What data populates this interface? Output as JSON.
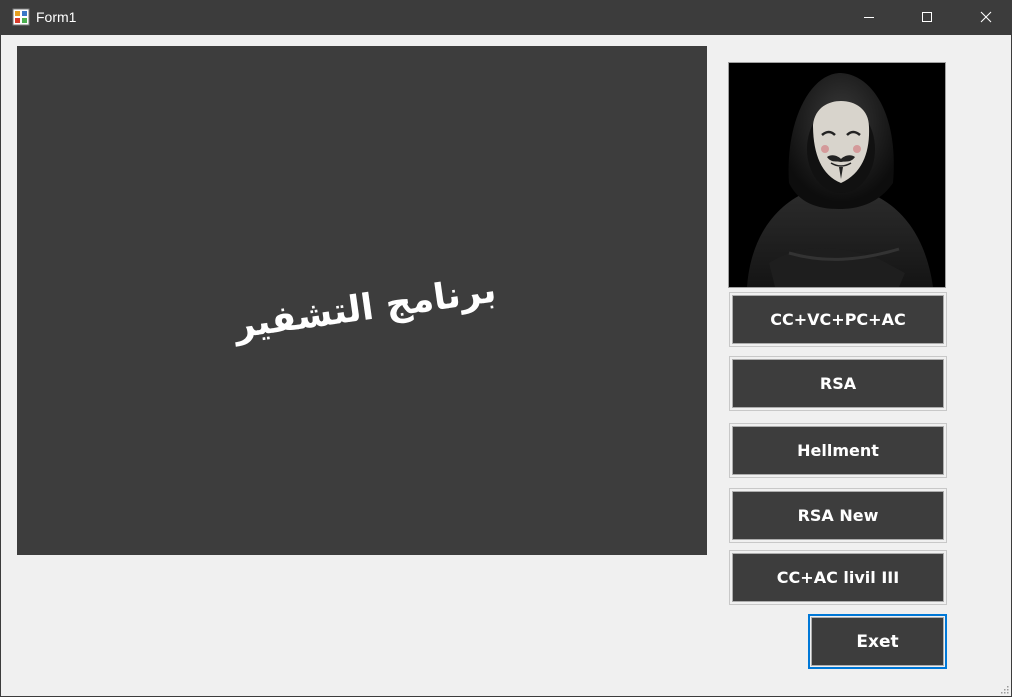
{
  "window": {
    "title": "Form1",
    "icon": "winforms-app-icon",
    "controls": [
      "minimize-icon",
      "maximize-icon",
      "close-icon"
    ]
  },
  "main": {
    "heading": "برنامج التشفير",
    "background_color": "#3d3d3d",
    "text_color": "#ffffff"
  },
  "sidebar": {
    "image": "anonymous-mask-hooded-figure",
    "buttons": [
      {
        "label": "CC+VC+PC+AC"
      },
      {
        "label": "RSA"
      },
      {
        "label": "Hellment"
      },
      {
        "label": "RSA New"
      },
      {
        "label": "CC+AC livil III"
      }
    ]
  },
  "exit_button": {
    "label": "Exet",
    "focus_color": "#0078d7"
  }
}
